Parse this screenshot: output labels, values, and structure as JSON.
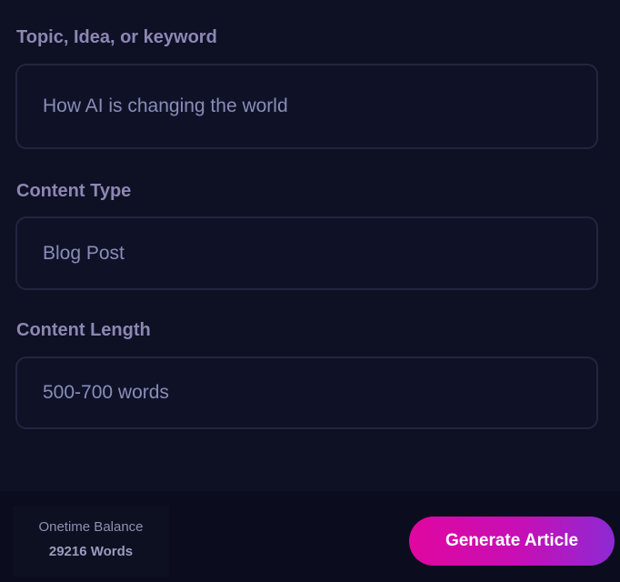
{
  "form": {
    "topic": {
      "label": "Topic, Idea, or keyword",
      "value": "How AI is changing the world"
    },
    "content_type": {
      "label": "Content Type",
      "value": "Blog Post"
    },
    "content_length": {
      "label": "Content Length",
      "value": "500-700 words"
    }
  },
  "footer": {
    "balance_label": "Onetime Balance",
    "balance_value": "29216 Words",
    "generate_label": "Generate Article"
  },
  "colors": {
    "background": "#0e1024",
    "label": "#8a88b3",
    "button_gradient_start": "#e0079f",
    "button_gradient_end": "#8d2ad3"
  }
}
